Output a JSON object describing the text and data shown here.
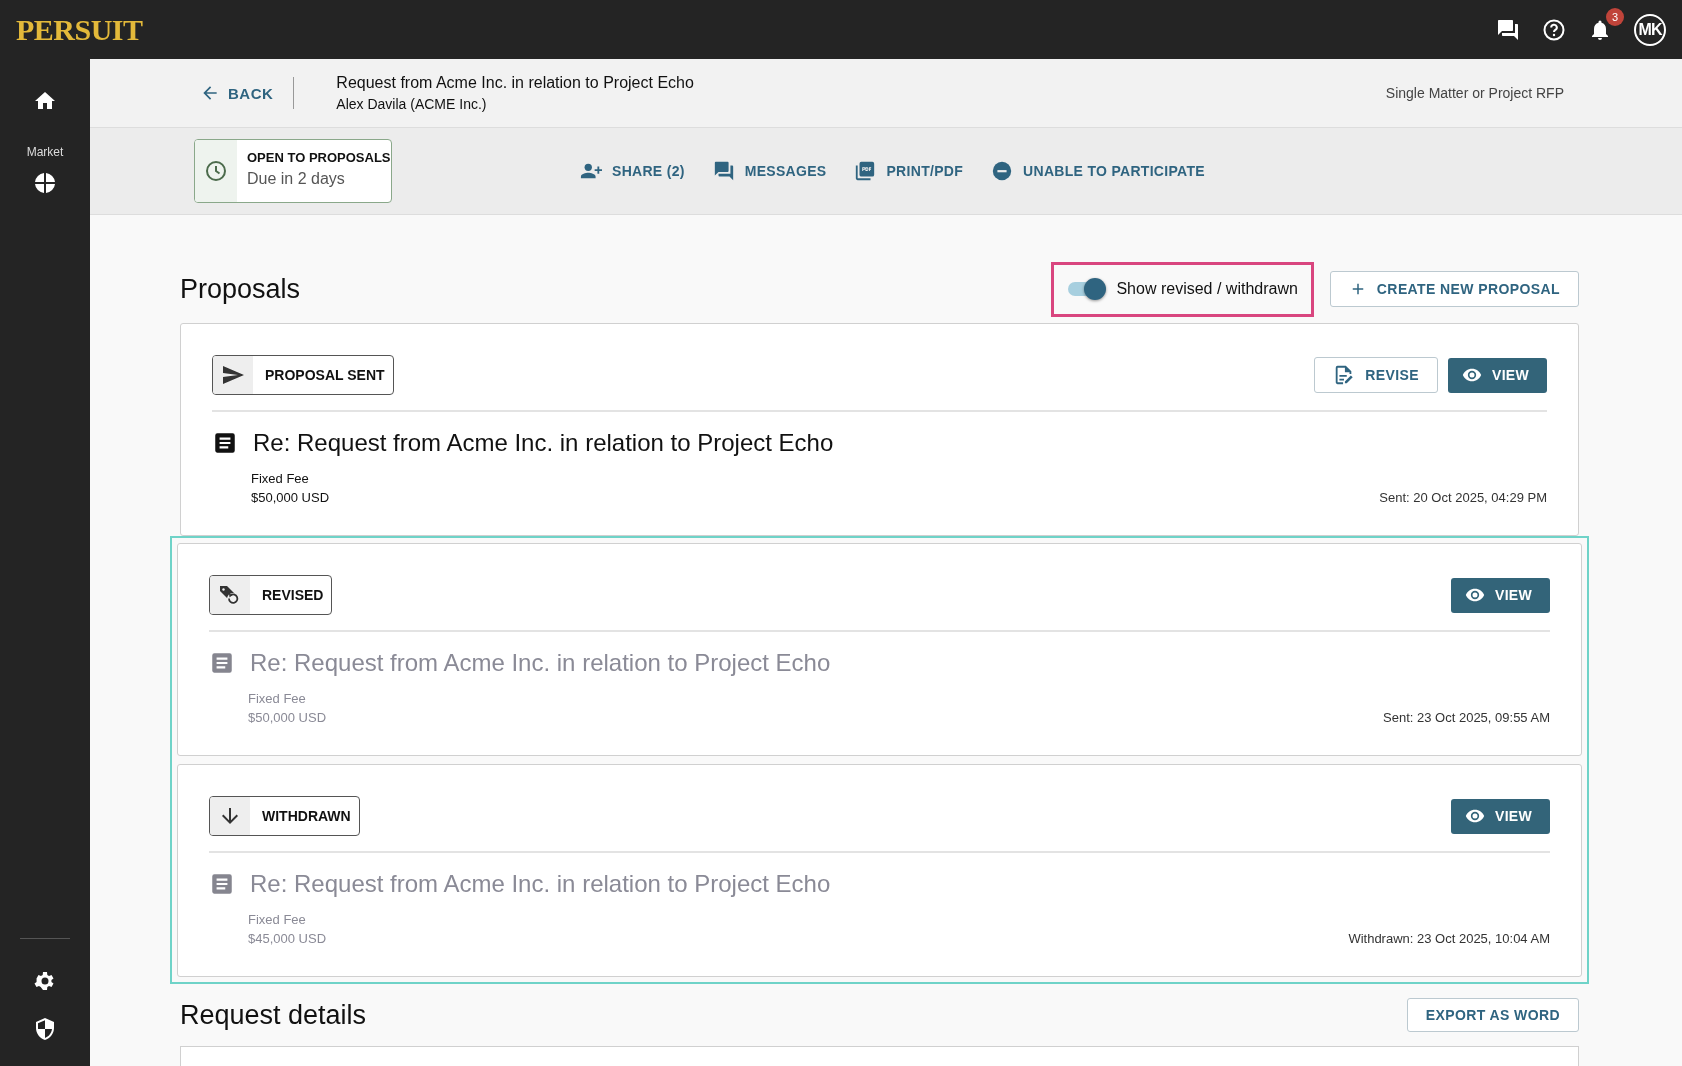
{
  "topbar": {
    "logo": "PERSUIT",
    "notification_count": "3",
    "avatar": "MK"
  },
  "sidebar": {
    "items": [
      {
        "kind": "home"
      },
      {
        "kind": "label",
        "label": "Market"
      },
      {
        "kind": "market"
      }
    ],
    "bottom_items": [
      {
        "kind": "settings"
      },
      {
        "kind": "security"
      }
    ]
  },
  "header": {
    "back": "BACK",
    "title": "Request from Acme Inc. in relation to Project Echo",
    "subtitle": "Alex Davila (ACME Inc.)",
    "rfp_type": "Single Matter or Project RFP"
  },
  "status": {
    "label": "OPEN TO PROPOSALS",
    "due": "Due in 2 days"
  },
  "actions": [
    {
      "kind": "share",
      "label": "SHARE (2)"
    },
    {
      "kind": "messages",
      "label": "MESSAGES"
    },
    {
      "kind": "print",
      "label": "PRINT/PDF"
    },
    {
      "kind": "decline",
      "label": "UNABLE TO PARTICIPATE"
    }
  ],
  "proposals_section": {
    "title": "Proposals",
    "toggle": {
      "label": "Show revised / withdrawn",
      "on": true,
      "highlighted": true
    },
    "create_button": "CREATE NEW PROPOSAL"
  },
  "proposals": [
    {
      "kind": "sent",
      "status": "PROPOSAL SENT",
      "title": "Re: Request from Acme Inc. in relation to Project Echo",
      "fee_type": "Fixed Fee",
      "amount": "$50,000 USD",
      "date": "Sent: 20 Oct 2025, 04:29 PM",
      "muted": false,
      "highlighted": false,
      "buttons": [
        {
          "kind": "revise",
          "label": "REVISE"
        },
        {
          "kind": "view",
          "label": "VIEW"
        }
      ]
    },
    {
      "kind": "revised",
      "status": "REVISED",
      "title": "Re: Request from Acme Inc. in relation to Project Echo",
      "fee_type": "Fixed Fee",
      "amount": "$50,000 USD",
      "date": "Sent: 23 Oct 2025, 09:55 AM",
      "muted": true,
      "highlighted": true,
      "buttons": [
        {
          "kind": "view",
          "label": "VIEW"
        }
      ]
    },
    {
      "kind": "withdrawn",
      "status": "WITHDRAWN",
      "title": "Re: Request from Acme Inc. in relation to Project Echo",
      "fee_type": "Fixed Fee",
      "amount": "$45,000 USD",
      "date": "Withdrawn: 23 Oct 2025, 10:04 AM",
      "muted": true,
      "highlighted": true,
      "buttons": [
        {
          "kind": "view",
          "label": "VIEW"
        }
      ]
    }
  ],
  "request_details": {
    "title": "Request details",
    "export_button": "EXPORT AS WORD"
  }
}
